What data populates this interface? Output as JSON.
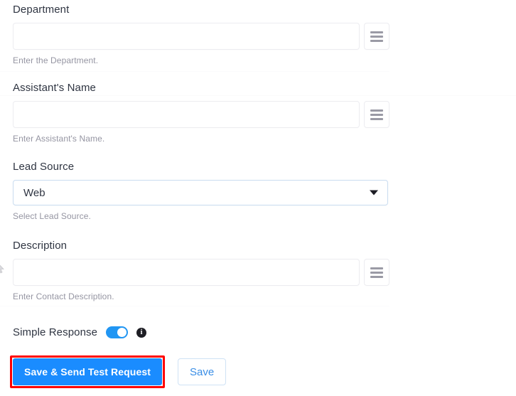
{
  "form": {
    "fields": [
      {
        "label": "Department",
        "value": "",
        "placeholder": "",
        "helper": "Enter the Department.",
        "merge_icon": "hamburger-icon",
        "type": "text"
      },
      {
        "label": "Assistant's Name",
        "value": "",
        "placeholder": "",
        "helper": "Enter Assistant's Name.",
        "merge_icon": "hamburger-icon",
        "type": "text"
      },
      {
        "label": "Lead Source",
        "value": "Web",
        "helper": "Select Lead Source.",
        "caret_icon": "chevron-down-icon",
        "type": "select",
        "options": [
          "Web"
        ]
      },
      {
        "label": "Description",
        "value": "",
        "placeholder": "",
        "helper": "Enter Contact Description.",
        "merge_icon": "hamburger-icon",
        "type": "text"
      }
    ]
  },
  "toggle_row": {
    "label": "Simple Response",
    "state": "on",
    "info_icon": "info-icon",
    "info_glyph": "i"
  },
  "actions": {
    "primary_label": "Save & Send Test Request",
    "secondary_label": "Save",
    "primary_highlighted": true
  },
  "colors": {
    "primary_button_bg": "#1a8cff",
    "secondary_button_text": "#3a8ee6",
    "annotation_outline": "#ff0000",
    "toggle_on": "#2196f3",
    "label_text": "#2f3542",
    "helper_text": "#9595a2",
    "select_border": "#c9dcf0",
    "input_border": "#ececf0"
  }
}
